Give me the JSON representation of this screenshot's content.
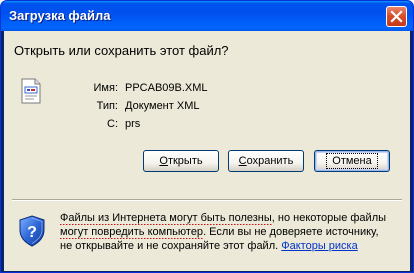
{
  "window": {
    "title": "Загрузка файла",
    "title_bar_color": "#0054e3",
    "close_icon": "close-icon"
  },
  "dialog": {
    "heading": "Открыть или сохранить этот файл?",
    "file_icon": "xml-document-icon",
    "fields": [
      {
        "label": "Имя:",
        "value": "PPCAB09B.XML"
      },
      {
        "label": "Тип:",
        "value": "Документ XML"
      },
      {
        "label": "С:",
        "value": "prs"
      }
    ]
  },
  "buttons": {
    "open": {
      "label": "Открыть",
      "accelerator": "О",
      "rest": "ткрыть"
    },
    "save": {
      "label": "Сохранить",
      "accelerator": "С",
      "rest": "охранить"
    },
    "cancel": {
      "label": "Отмена"
    }
  },
  "warning": {
    "icon": "shield-question-icon",
    "text_line1_part1": "Файлы из Интернета могут быть полезны",
    "text_line1_part2": ", но некоторые файлы",
    "text_line2_part1": "могут повредить компьютер",
    "text_line2_part2": ". Если вы не доверяете источнику,",
    "text_line3": "не открывайте и не сохраняйте этот файл. ",
    "link": "Факторы риска"
  },
  "colors": {
    "dialog_background": "#ece9d8",
    "link": "#0033cc",
    "button_border": "#003c74"
  }
}
